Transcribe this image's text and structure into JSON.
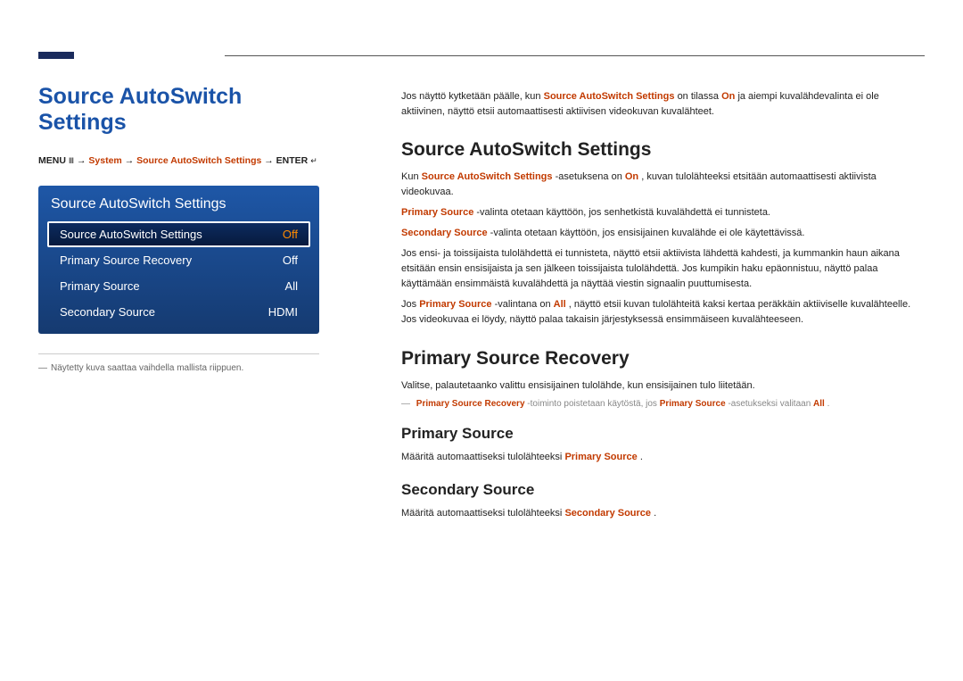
{
  "page_title": "Source AutoSwitch Settings",
  "menu_path": {
    "prefix": "MENU",
    "menu_icon": "Ⅲ",
    "arrow": " → ",
    "system": "System",
    "item": "Source AutoSwitch Settings",
    "enter": "ENTER",
    "enter_icon": "↵"
  },
  "osd": {
    "title": "Source AutoSwitch Settings",
    "items": [
      {
        "label": "Source AutoSwitch Settings",
        "value": "Off",
        "selected": true
      },
      {
        "label": "Primary Source Recovery",
        "value": "Off",
        "selected": false
      },
      {
        "label": "Primary Source",
        "value": "All",
        "selected": false
      },
      {
        "label": "Secondary Source",
        "value": "HDMI",
        "selected": false
      }
    ]
  },
  "left_footnote": "Näytetty kuva saattaa vaihdella mallista riippuen.",
  "intro": {
    "p1a": "Jos näyttö kytketään päälle, kun ",
    "p1_hl1": "Source AutoSwitch Settings",
    "p1b": " on tilassa ",
    "p1_hl2": "On",
    "p1c": " ja aiempi kuvalähdevalinta ei ole aktiivinen, näyttö etsii automaattisesti aktiivisen videokuvan kuvalähteet."
  },
  "sec1": {
    "heading": "Source AutoSwitch Settings",
    "p1a": "Kun ",
    "p1_hl1": "Source AutoSwitch Settings",
    "p1b": " -asetuksena on ",
    "p1_hl2": "On",
    "p1c": ", kuvan tulolähteeksi etsitään automaattisesti aktiivista videokuvaa.",
    "p2_hl": "Primary Source",
    "p2": " -valinta otetaan käyttöön, jos senhetkistä kuvalähdettä ei tunnisteta.",
    "p3_hl": "Secondary Source",
    "p3": " -valinta otetaan käyttöön, jos ensisijainen kuvalähde ei ole käytettävissä.",
    "p4": "Jos ensi- ja toissijaista tulolähdettä ei tunnisteta, näyttö etsii aktiivista lähdettä kahdesti, ja kummankin haun aikana etsitään ensin ensisijaista ja sen jälkeen toissijaista tulolähdettä. Jos kumpikin haku epäonnistuu, näyttö palaa käyttämään ensimmäistä kuvalähdettä ja näyttää viestin signaalin puuttumisesta.",
    "p5a": "Jos ",
    "p5_hl1": "Primary Source",
    "p5b": " -valintana on ",
    "p5_hl2": "All",
    "p5c": ", näyttö etsii kuvan tulolähteitä kaksi kertaa peräkkäin aktiiviselle kuvalähteelle. Jos videokuvaa ei löydy, näyttö palaa takaisin järjestyksessä ensimmäiseen kuvalähteeseen."
  },
  "sec2": {
    "heading": "Primary Source Recovery",
    "p1": "Valitse, palautetaanko valittu ensisijainen tulolähde, kun ensisijainen tulo liitetään.",
    "note_hl1": "Primary Source Recovery",
    "note_mid": " -toiminto poistetaan käytöstä, jos ",
    "note_hl2": "Primary Source",
    "note_mid2": " -asetukseksi valitaan ",
    "note_hl3": "All",
    "note_end": "."
  },
  "sec3": {
    "heading": "Primary Source",
    "p1a": "Määritä automaattiseksi tulolähteeksi ",
    "p1_hl": "Primary Source",
    "p1b": "."
  },
  "sec4": {
    "heading": "Secondary Source",
    "p1a": "Määritä automaattiseksi tulolähteeksi ",
    "p1_hl": "Secondary Source",
    "p1b": "."
  }
}
